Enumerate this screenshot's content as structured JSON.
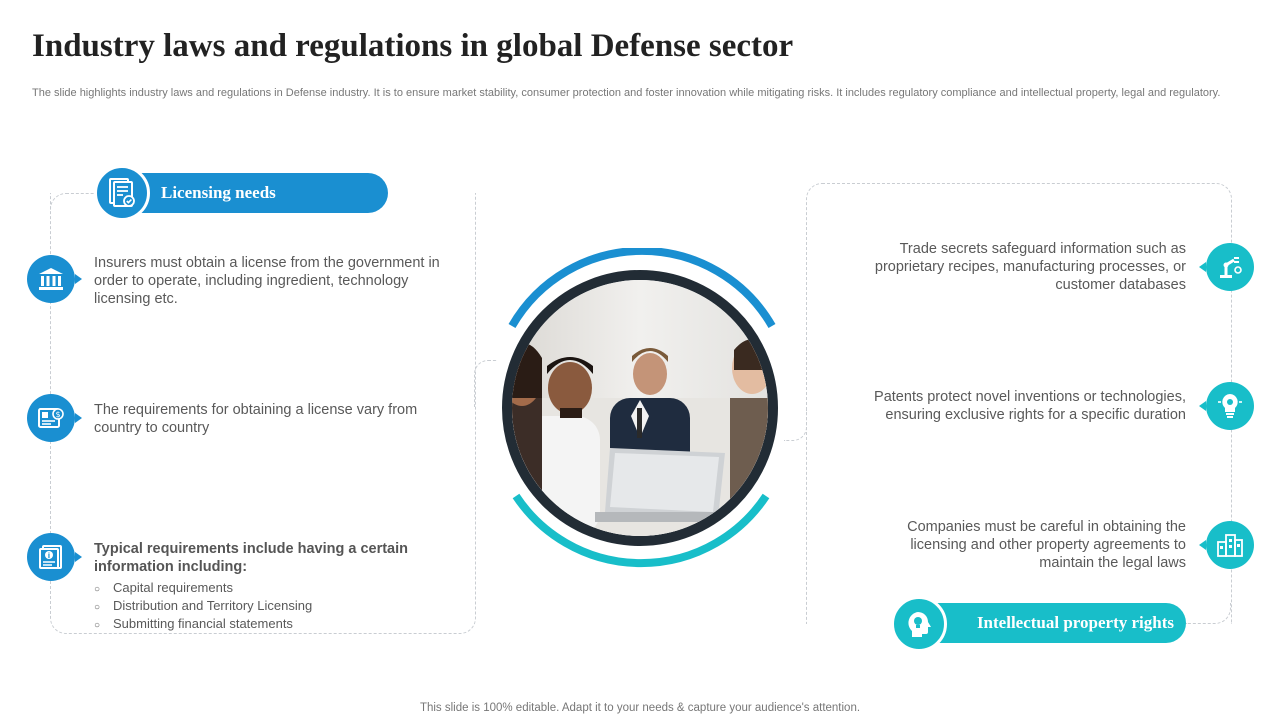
{
  "title": "Industry laws and regulations in global Defense sector",
  "subtitle": "The slide highlights industry laws and regulations in Defense industry. It is to ensure market stability, consumer protection and foster innovation while mitigating risks.  It includes regulatory compliance and intellectual property, legal and regulatory.",
  "left": {
    "header": "Licensing needs",
    "items": [
      {
        "text": "Insurers must obtain a license from the government in order to operate, including ingredient, technology licensing etc.",
        "icon": "bank-icon"
      },
      {
        "text": "The requirements for obtaining a license vary from country to country",
        "icon": "id-card-icon"
      },
      {
        "heading": "Typical requirements include having a certain information including:",
        "icon": "info-document-icon",
        "list": [
          "Capital requirements",
          "Distribution and Territory Licensing",
          "Submitting financial statements"
        ]
      }
    ]
  },
  "right": {
    "header": "Intellectual property rights",
    "items": [
      {
        "text": "Trade secrets safeguard information such as proprietary recipes, manufacturing processes, or customer databases",
        "icon": "robot-arm-icon"
      },
      {
        "text": "Patents protect novel inventions or technologies, ensuring exclusive rights for a specific duration",
        "icon": "lightbulb-gear-icon"
      },
      {
        "text": "Companies must be careful in obtaining the licensing and other property agreements to maintain the legal laws",
        "icon": "buildings-icon"
      }
    ]
  },
  "footer": "This slide is 100% editable. Adapt it to your needs & capture your audience's attention.",
  "colors": {
    "blue": "#1a8fd1",
    "teal": "#18bec9",
    "dark": "#222c35",
    "dash": "#c9cdd2"
  }
}
